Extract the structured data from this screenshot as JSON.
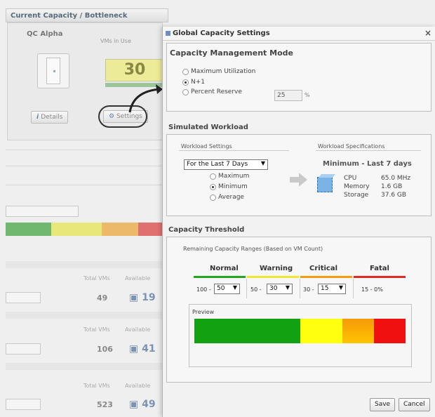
{
  "background": {
    "header": "Current Capacity / Bottleneck",
    "cluster_name": "QC Alpha",
    "vms_in_use_label": "VMs in Use",
    "vms_in_use_value": "30",
    "details_label": "Details",
    "settings_label": "Settings",
    "rows": [
      {
        "total_label": "Total VMs",
        "avail_label": "Available",
        "total": "49",
        "available": "19"
      },
      {
        "total_label": "Total VMs",
        "avail_label": "Available",
        "total": "106",
        "available": "41"
      },
      {
        "total_label": "Total VMs",
        "avail_label": "Available",
        "total": "523",
        "available": "49"
      }
    ]
  },
  "dialog": {
    "title": "Global Capacity Settings",
    "close": "×",
    "mode": {
      "heading": "Capacity Management Mode",
      "options": [
        "Maximum Utilization",
        "N+1",
        "Percent Reserve"
      ],
      "selected": "N+1",
      "reserve_value": "25",
      "reserve_unit": "%"
    },
    "workload": {
      "heading": "Simulated Workload",
      "settings_label": "Workload Settings",
      "specs_label": "Workload Specifications",
      "period": "For the Last 7 Days",
      "options": [
        "Maximum",
        "Minimum",
        "Average"
      ],
      "selected": "Minimum",
      "spec_title": "Minimum - Last 7 days",
      "cpu_label": "CPU",
      "cpu_value": "65.0 MHz",
      "memory_label": "Memory",
      "memory_value": "1.6 GB",
      "storage_label": "Storage",
      "storage_value": "37.6 GB"
    },
    "threshold": {
      "heading": "Capacity Threshold",
      "ranges_label": "Remaining Capacity Ranges (Based on VM Count)",
      "levels": [
        {
          "label": "Normal",
          "prefix": "100 -",
          "value": "50",
          "color": "#22a722"
        },
        {
          "label": "Warning",
          "prefix": "50 -",
          "value": "30",
          "color": "#f0e830"
        },
        {
          "label": "Critical",
          "prefix": "30 -",
          "value": "15",
          "color": "#f39c12"
        },
        {
          "label": "Fatal",
          "prefix": "15 - 0%",
          "value": "",
          "color": "#e02a2a"
        }
      ],
      "preview_label": "Preview"
    },
    "save": "Save",
    "cancel": "Cancel"
  }
}
